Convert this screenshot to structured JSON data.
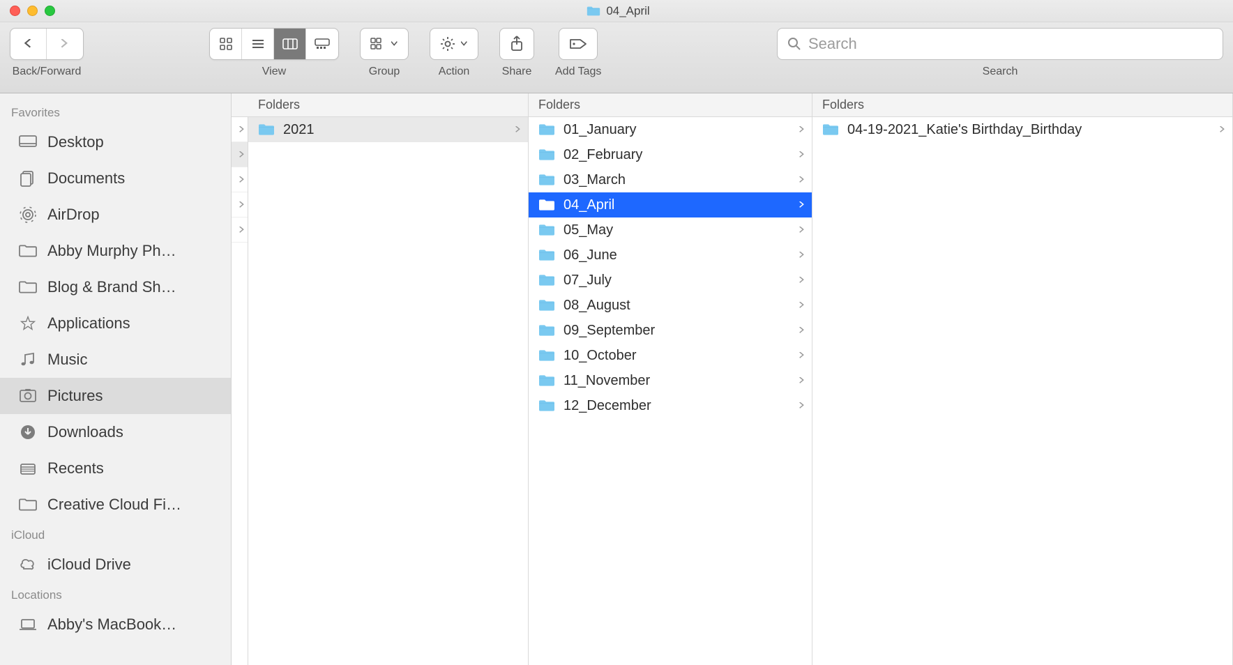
{
  "window": {
    "title": "04_April"
  },
  "toolbar": {
    "back_forward_label": "Back/Forward",
    "view_label": "View",
    "group_label": "Group",
    "action_label": "Action",
    "share_label": "Share",
    "tags_label": "Add Tags",
    "search_label": "Search",
    "search_placeholder": "Search"
  },
  "sidebar": {
    "sections": [
      {
        "title": "Favorites",
        "items": [
          {
            "label": "Desktop",
            "icon": "desktop"
          },
          {
            "label": "Documents",
            "icon": "documents"
          },
          {
            "label": "AirDrop",
            "icon": "airdrop"
          },
          {
            "label": "Abby Murphy Ph…",
            "icon": "folder"
          },
          {
            "label": "Blog & Brand Sh…",
            "icon": "folder"
          },
          {
            "label": "Applications",
            "icon": "applications"
          },
          {
            "label": "Music",
            "icon": "music"
          },
          {
            "label": "Pictures",
            "icon": "pictures",
            "active": true
          },
          {
            "label": "Downloads",
            "icon": "downloads"
          },
          {
            "label": "Recents",
            "icon": "recents"
          },
          {
            "label": "Creative Cloud Fi…",
            "icon": "folder"
          }
        ]
      },
      {
        "title": "iCloud",
        "items": [
          {
            "label": "iCloud Drive",
            "icon": "cloud"
          }
        ]
      },
      {
        "title": "Locations",
        "items": [
          {
            "label": "Abby's MacBook…",
            "icon": "laptop"
          }
        ]
      }
    ]
  },
  "columns": {
    "header": "Folders",
    "col1": {
      "items": [
        {
          "label": "2021"
        }
      ],
      "selected_index": 0,
      "stub_count": 5
    },
    "col2": {
      "items": [
        {
          "label": "01_January"
        },
        {
          "label": "02_February"
        },
        {
          "label": "03_March"
        },
        {
          "label": "04_April"
        },
        {
          "label": "05_May"
        },
        {
          "label": "06_June"
        },
        {
          "label": "07_July"
        },
        {
          "label": "08_August"
        },
        {
          "label": "09_September"
        },
        {
          "label": "10_October"
        },
        {
          "label": "11_November"
        },
        {
          "label": "12_December"
        }
      ],
      "selected_index": 3
    },
    "col3": {
      "items": [
        {
          "label": "04-19-2021_Katie's Birthday_Birthday"
        }
      ]
    }
  }
}
